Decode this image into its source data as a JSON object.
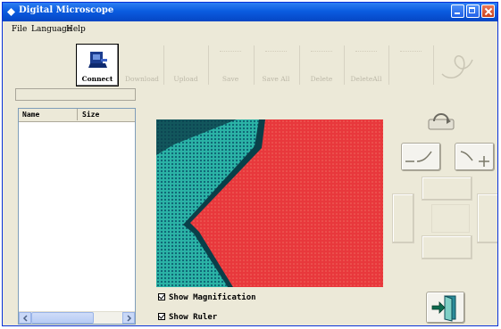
{
  "window": {
    "title": "Digital Microscope"
  },
  "menu": [
    "File",
    "Language",
    "Help"
  ],
  "toolbar": {
    "connect": "Connect",
    "download": "Download",
    "upload": "Upload",
    "save": "Save",
    "save_all": "Save All",
    "delete": "Delete",
    "delete_all": "DeleteAll"
  },
  "file_list": {
    "columns": [
      "Name",
      "Size"
    ],
    "rows": []
  },
  "options": {
    "show_magnification": "Show Magnification",
    "show_ruler": "Show Ruler"
  },
  "controls": {
    "zoom_out_icon": "zoom-out-icon",
    "zoom_in_icon": "zoom-in-icon",
    "rotate_icon": "rotate-icon",
    "exit_icon": "exit-door-icon"
  },
  "colors": {
    "title_bar": "#0b5ce0",
    "window_bg": "#ece9d8",
    "specimen_red": "#e63a3e",
    "specimen_cyan": "#2fb7a7"
  }
}
